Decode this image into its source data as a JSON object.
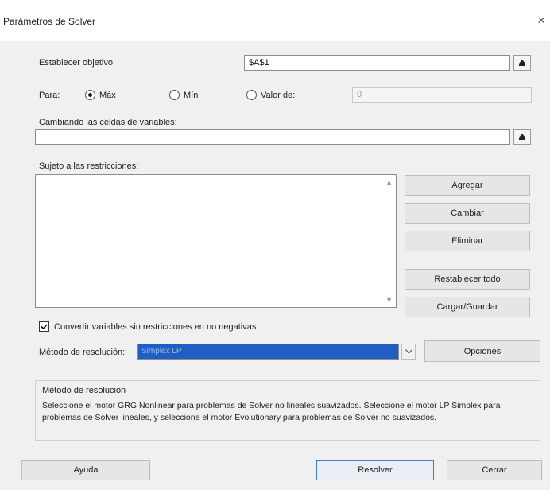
{
  "window": {
    "title": "Parámetros de Solver",
    "close": "×"
  },
  "objective": {
    "label": "Establecer objetivo:",
    "value": "$A$1"
  },
  "para": {
    "label": "Para:",
    "options": [
      {
        "label": "Máx",
        "checked": true
      },
      {
        "label": "Mín",
        "checked": false
      },
      {
        "label": "Valor de:",
        "checked": false
      }
    ],
    "valor_value": "0"
  },
  "cambiando": {
    "label": "Cambiando las celdas de variables:",
    "value": ""
  },
  "restricciones": {
    "label": "Sujeto a las restricciones:"
  },
  "side_buttons": [
    "Agregar",
    "Cambiar",
    "Eliminar",
    "Restablecer todo",
    "Cargar/Guardar"
  ],
  "checkbox": {
    "label": "Convertir variables sin restricciones en no negativas",
    "checked": true
  },
  "metodo": {
    "label": "Método de resolución:",
    "value": "Simplex LP",
    "opciones": "Opciones"
  },
  "group": {
    "title": "Método de resolución",
    "text": "Seleccione el motor GRG Nonlinear para problemas de Solver no lineales suavizados. Seleccione el motor LP Simplex para problemas de Solver lineales, y seleccione el motor Evolutionary para problemas de Solver no suavizados."
  },
  "footer": {
    "ayuda": "Ayuda",
    "resolver": "Resolver",
    "cerrar": "Cerrar"
  },
  "colors": {
    "accent": "#1f5fc4",
    "default_border": "#3c7fd0"
  }
}
